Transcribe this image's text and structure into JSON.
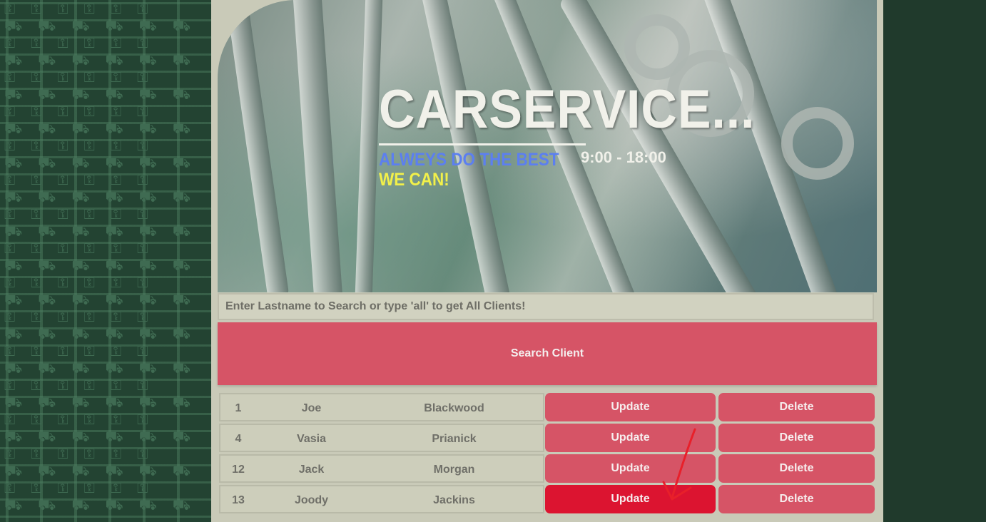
{
  "header": {
    "title": "CARSERVICE...",
    "tagline_line1": "ALWEYS DO THE BEST",
    "tagline_line2": "WE CAN!",
    "hours": "9:00 - 18:00"
  },
  "search": {
    "placeholder": "Enter Lastname to Search or type 'all' to get All Clients!",
    "button_label": "Search Client"
  },
  "clients": [
    {
      "id": "1",
      "first": "Joe",
      "last": "Blackwood",
      "update": "Update",
      "delete": "Delete"
    },
    {
      "id": "4",
      "first": "Vasia",
      "last": "Prianick",
      "update": "Update",
      "delete": "Delete"
    },
    {
      "id": "12",
      "first": "Jack",
      "last": "Morgan",
      "update": "Update",
      "delete": "Delete"
    },
    {
      "id": "13",
      "first": "Joody",
      "last": "Jackins",
      "update": "Update",
      "delete": "Delete"
    }
  ],
  "colors": {
    "accent": "#d65466",
    "accent_active": "#dc1430",
    "background": "#213d2e",
    "panel": "#c9cab8",
    "tagline_blue": "#5c7ff0",
    "tagline_yellow": "#f2f04a"
  },
  "background_icons": [
    "car-icon",
    "key-icon"
  ],
  "annotation": "red-arrow-icon"
}
